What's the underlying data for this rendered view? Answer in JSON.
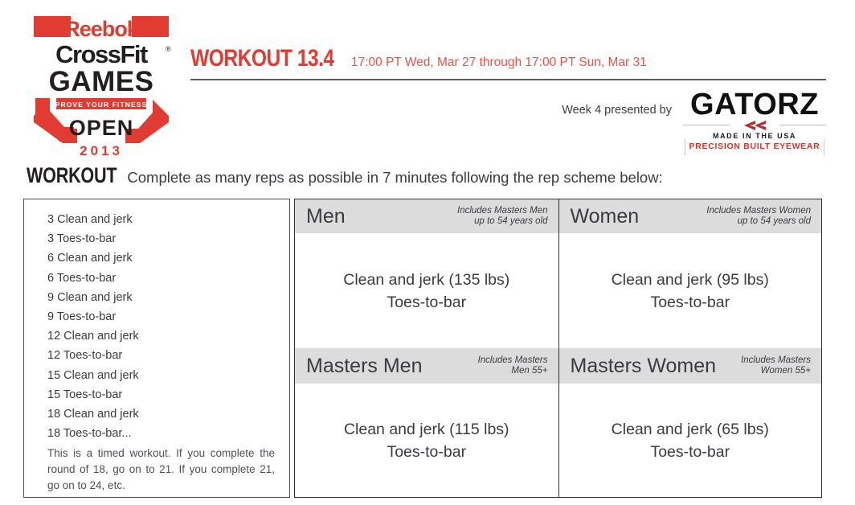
{
  "logo": {
    "brand": "Reebok",
    "line1": "CrossFit",
    "line2": "GAMES",
    "tagline": "PROVE YOUR FITNESS",
    "line3": "OPEN",
    "year": "2013",
    "red": "#e03c31",
    "black": "#231f20"
  },
  "header": {
    "workout_number": "WORKOUT 13.4",
    "dates": "17:00 PT Wed, Mar 27 through 17:00 PT Sun, Mar 31",
    "presented_by": "Week 4 presented by",
    "sponsor_name": "GATORZ",
    "sponsor_made_in": "MADE IN THE USA",
    "sponsor_tagline": "PRECISION BUILT EYEWEAR",
    "accent_red": "#e03c31"
  },
  "workout": {
    "label": "WORKOUT",
    "description": "Complete as many reps as possible in 7 minutes following the rep scheme below:"
  },
  "rep_scheme": {
    "items": [
      "3 Clean and jerk",
      "3 Toes-to-bar",
      "6 Clean and jerk",
      "6 Toes-to-bar",
      "9 Clean and jerk",
      "9 Toes-to-bar",
      "12 Clean and jerk",
      "12 Toes-to-bar",
      "15 Clean and jerk",
      "15 Toes-to-bar",
      "18 Clean and jerk",
      "18 Toes-to-bar..."
    ],
    "note": "This is a timed workout. If you complete the round of 18, go on to 21. If you complete 21, go on to 24, etc."
  },
  "divisions": {
    "men": {
      "title": "Men",
      "note_line1": "Includes Masters Men",
      "note_line2": "up to 54 years old",
      "movement1": "Clean and jerk (135 lbs)",
      "movement2": "Toes-to-bar"
    },
    "women": {
      "title": "Women",
      "note_line1": "Includes Masters Women",
      "note_line2": "up to 54 years old",
      "movement1": "Clean and jerk (95 lbs)",
      "movement2": "Toes-to-bar"
    },
    "masters_men": {
      "title": "Masters Men",
      "note_line1": "Includes Masters",
      "note_line2": "Men 55+",
      "movement1": "Clean and jerk (115 lbs)",
      "movement2": "Toes-to-bar"
    },
    "masters_women": {
      "title": "Masters Women",
      "note_line1": "Includes Masters",
      "note_line2": "Women 55+",
      "movement1": "Clean and jerk (65 lbs)",
      "movement2": "Toes-to-bar"
    }
  }
}
